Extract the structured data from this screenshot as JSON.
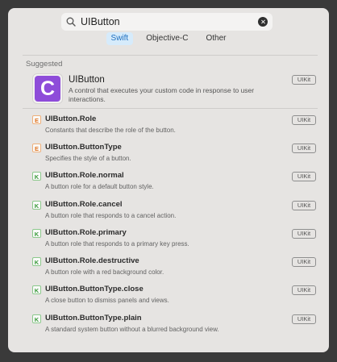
{
  "search": {
    "value": "UIButton"
  },
  "language_tabs": [
    {
      "label": "Swift",
      "active": true
    },
    {
      "label": "Objective-C",
      "active": false
    },
    {
      "label": "Other",
      "active": false
    }
  ],
  "section_label": "Suggested",
  "featured": {
    "icon_letter": "C",
    "title": "UIButton",
    "description": "A control that executes your custom code in response to user interactions.",
    "framework": "UIKit"
  },
  "results": [
    {
      "kind": "E",
      "title": "UIButton.Role",
      "description": "Constants that describe the role of the button.",
      "framework": "UIKit"
    },
    {
      "kind": "E",
      "title": "UIButton.ButtonType",
      "description": "Specifies the style of a button.",
      "framework": "UIKit"
    },
    {
      "kind": "K",
      "title": "UIButton.Role.normal",
      "description": "A button role for a default button style.",
      "framework": "UIKit"
    },
    {
      "kind": "K",
      "title": "UIButton.Role.cancel",
      "description": "A button role that responds to a cancel action.",
      "framework": "UIKit"
    },
    {
      "kind": "K",
      "title": "UIButton.Role.primary",
      "description": "A button role that responds to a primary key press.",
      "framework": "UIKit"
    },
    {
      "kind": "K",
      "title": "UIButton.Role.destructive",
      "description": "A button role with a red background color.",
      "framework": "UIKit"
    },
    {
      "kind": "K",
      "title": "UIButton.ButtonType.close",
      "description": "A close button to dismiss panels and views.",
      "framework": "UIKit"
    },
    {
      "kind": "K",
      "title": "UIButton.ButtonType.plain",
      "description": "A standard system button without a blurred background view.",
      "framework": "UIKit"
    }
  ],
  "colors": {
    "accent": "#1f6fbf",
    "class_badge": "#8e4cd9",
    "enum_kind": "#e0731f",
    "constant_kind": "#3a9a3a"
  }
}
